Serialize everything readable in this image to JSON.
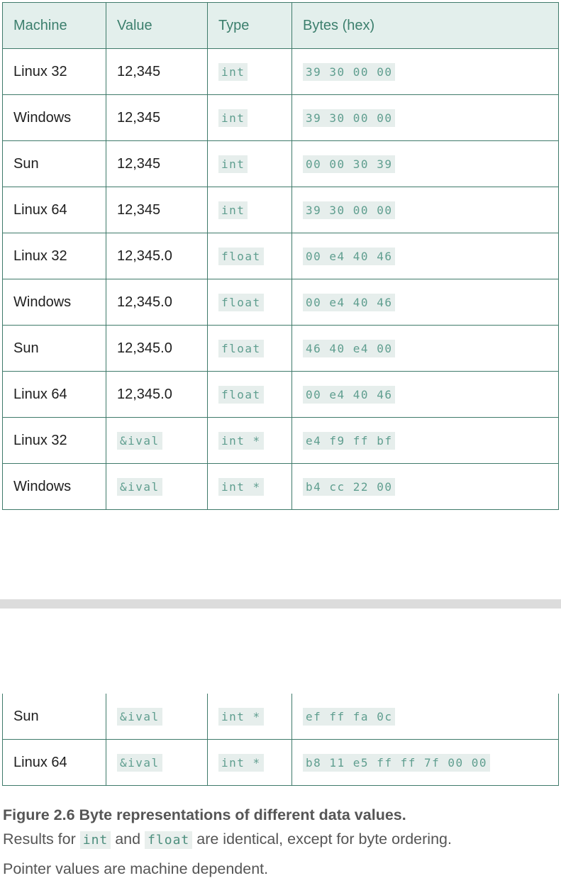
{
  "table": {
    "headers": [
      "Machine",
      "Value",
      "Type",
      "Bytes (hex)"
    ],
    "rows_top": [
      {
        "machine": "Linux 32",
        "value": "12,345",
        "type": "int",
        "bytes": "39 30 00 00"
      },
      {
        "machine": "Windows",
        "value": "12,345",
        "type": "int",
        "bytes": "39 30 00 00"
      },
      {
        "machine": "Sun",
        "value": "12,345",
        "type": "int",
        "bytes": "00 00 30 39"
      },
      {
        "machine": "Linux 64",
        "value": "12,345",
        "type": "int",
        "bytes": "39 30 00 00"
      },
      {
        "machine": "Linux 32",
        "value": "12,345.0",
        "type": "float",
        "bytes": "00 e4 40 46"
      },
      {
        "machine": "Windows",
        "value": "12,345.0",
        "type": "float",
        "bytes": "00 e4 40 46"
      },
      {
        "machine": "Sun",
        "value": "12,345.0",
        "type": "float",
        "bytes": "46 40 e4 00"
      },
      {
        "machine": "Linux 64",
        "value": "12,345.0",
        "type": "float",
        "bytes": "00 e4 40 46"
      },
      {
        "machine": "Linux 32",
        "value": "&ival",
        "type": "int *",
        "bytes": "e4 f9 ff bf"
      },
      {
        "machine": "Windows",
        "value": "&ival",
        "type": "int *",
        "bytes": "b4 cc 22 00"
      }
    ],
    "rows_bottom": [
      {
        "machine": "Sun",
        "value": "&ival",
        "type": "int *",
        "bytes": "ef ff fa 0c"
      },
      {
        "machine": "Linux 64",
        "value": "&ival",
        "type": "int *",
        "bytes": "b8 11 e5 ff ff 7f 00 00"
      }
    ]
  },
  "caption": {
    "title": "Figure 2.6 Byte representations of different data values.",
    "line1_before": "Results for ",
    "line1_code1": "int",
    "line1_between": " and ",
    "line1_code2": "float",
    "line1_after": " are identical, except for byte ordering.",
    "line2": "Pointer values are machine dependent."
  }
}
